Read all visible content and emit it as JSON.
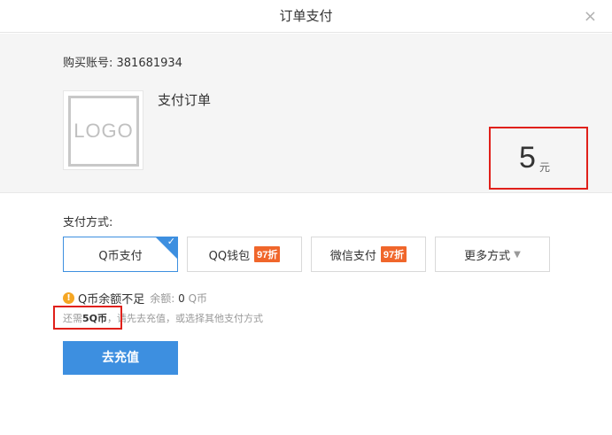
{
  "dialog": {
    "title": "订单支付",
    "close_glyph": "×"
  },
  "order": {
    "account_label": "购买账号: 381681934",
    "logo_text": "LOGO",
    "name": "支付订单",
    "price": "5",
    "price_unit": "元"
  },
  "payment": {
    "label": "支付方式:",
    "methods": [
      {
        "label": "Q币支付",
        "selected": true
      },
      {
        "label": "QQ钱包",
        "badge": "97折"
      },
      {
        "label": "微信支付",
        "badge": "97折"
      },
      {
        "label": "更多方式"
      }
    ],
    "more_arrow": "▼",
    "check_glyph": "✓"
  },
  "notice": {
    "icon_glyph": "!",
    "insufficient": "Q币余额不足",
    "balance_label": "余额:",
    "balance_value": "0",
    "balance_unit": "Q币",
    "need_prefix": "还需",
    "need_amount": "5Q币",
    "need_suffix": "，请先去充值，或选择其他支付方式"
  },
  "actions": {
    "recharge_label": "去充值"
  },
  "colors": {
    "accent": "#3d8fe0",
    "badge": "#f0662b",
    "highlight": "#e0201a",
    "warning": "#f5a623"
  }
}
